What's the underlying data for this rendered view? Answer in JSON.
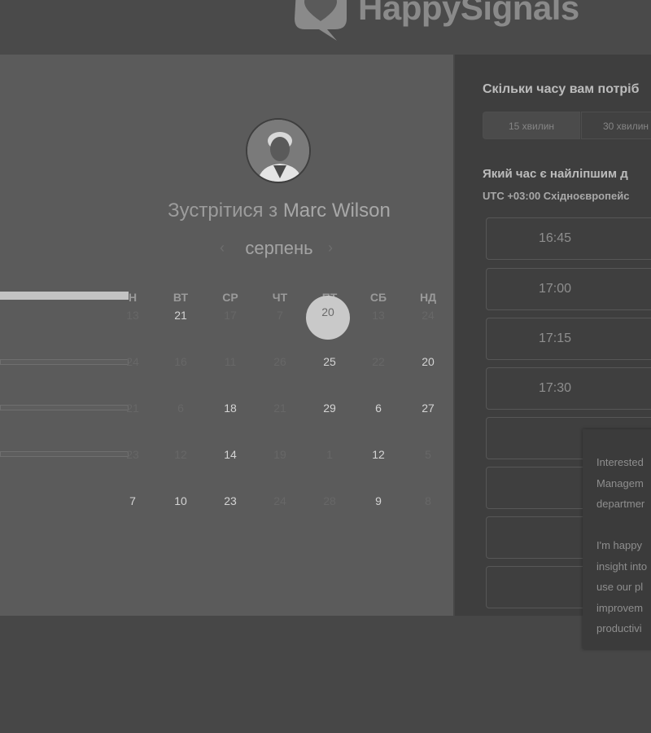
{
  "header": {
    "brand": "HappySignals",
    "logo_icon": "speech-heart-icon"
  },
  "meeting": {
    "title_prefix": "Зустрітися з",
    "host_name": "Marc Wilson",
    "avatar_icon": "host-avatar"
  },
  "calendar": {
    "month": "серпень",
    "prev_icon": "chevron-left-icon",
    "next_icon": "chevron-right-icon",
    "weekdays": [
      "Н",
      "ВТ",
      "СР",
      "ЧТ",
      "ПТ",
      "СБ",
      "НД"
    ],
    "selected_day": "20",
    "rows": [
      [
        {
          "d": "13",
          "on": false
        },
        {
          "d": "21",
          "on": true
        },
        {
          "d": "17",
          "on": false
        },
        {
          "d": "7",
          "on": false
        },
        {
          "d": "20",
          "on": true
        },
        {
          "d": "13",
          "on": false
        },
        {
          "d": "24",
          "on": false
        }
      ],
      [
        {
          "d": "24",
          "on": false
        },
        {
          "d": "16",
          "on": false
        },
        {
          "d": "11",
          "on": false
        },
        {
          "d": "26",
          "on": false
        },
        {
          "d": "25",
          "on": true
        },
        {
          "d": "22",
          "on": false
        },
        {
          "d": "20",
          "on": true
        }
      ],
      [
        {
          "d": "21",
          "on": false
        },
        {
          "d": "6",
          "on": false
        },
        {
          "d": "18",
          "on": true
        },
        {
          "d": "21",
          "on": false
        },
        {
          "d": "29",
          "on": true
        },
        {
          "d": "6",
          "on": true
        },
        {
          "d": "27",
          "on": true
        }
      ],
      [
        {
          "d": "23",
          "on": false
        },
        {
          "d": "12",
          "on": false
        },
        {
          "d": "14",
          "on": true
        },
        {
          "d": "19",
          "on": false
        },
        {
          "d": "1",
          "on": false
        },
        {
          "d": "12",
          "on": true
        },
        {
          "d": "5",
          "on": false
        }
      ],
      [
        {
          "d": "7",
          "on": true
        },
        {
          "d": "10",
          "on": true
        },
        {
          "d": "23",
          "on": true
        },
        {
          "d": "24",
          "on": false
        },
        {
          "d": "28",
          "on": false
        },
        {
          "d": "9",
          "on": true
        },
        {
          "d": "8",
          "on": false
        }
      ]
    ]
  },
  "booking": {
    "duration_question": "Скільки часу вам потріб",
    "durations": [
      "15 хвилин",
      "30 хвилин"
    ],
    "time_question": "Який час є найліпшим д",
    "timezone_offset": "UTC +03:00",
    "timezone_name": "Східноєвропейс",
    "slots": [
      "16:45",
      "17:00",
      "17:15",
      "17:30",
      "",
      "",
      "",
      ""
    ]
  },
  "popup": {
    "lines": [
      "Interested",
      "Managem",
      "departmer",
      "",
      "I'm happy",
      "insight into",
      "use our pl",
      "improvem",
      "productivi"
    ]
  }
}
